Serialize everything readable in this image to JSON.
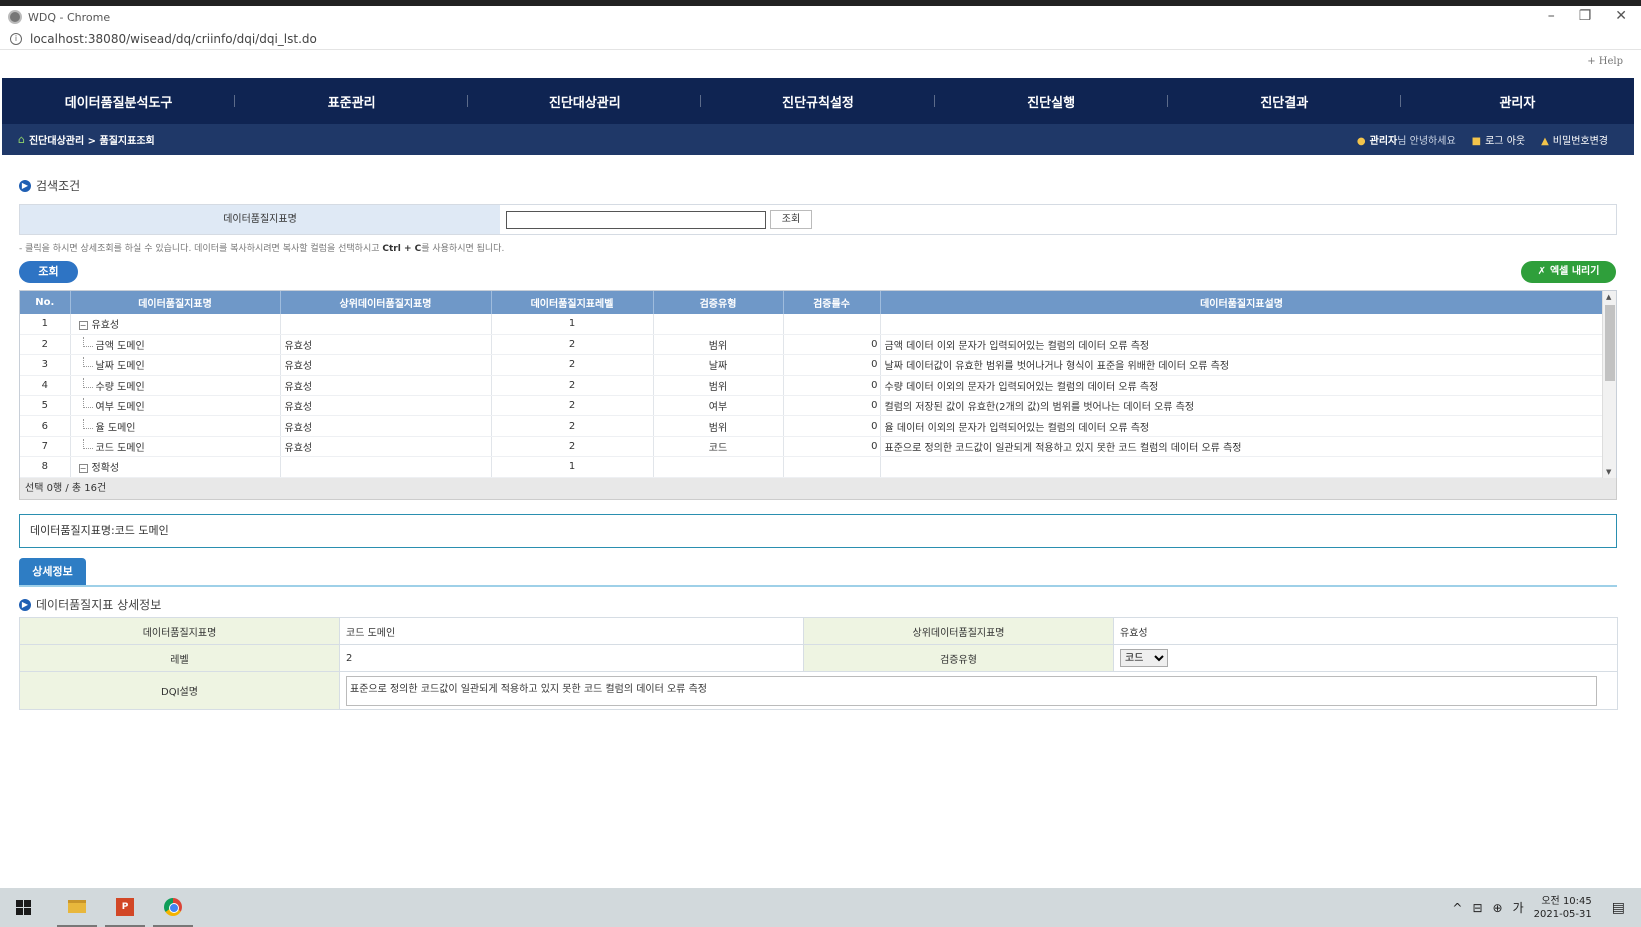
{
  "window": {
    "title": "WDQ - Chrome",
    "url": "localhost:38080/wisead/dq/criinfo/dqi/dqi_lst.do",
    "minimize": "–",
    "restore": "❐",
    "close": "✕"
  },
  "help": "+ Help",
  "nav": {
    "items": [
      "데이터품질분석도구",
      "표준관리",
      "진단대상관리",
      "진단규칙설정",
      "진단실행",
      "진단결과",
      "관리자"
    ]
  },
  "subbar": {
    "breadcrumb": "진단대상관리 > 품질지표조회",
    "user_name": "관리자",
    "user_greeting": "님 안녕하세요",
    "logout": "로그 아웃",
    "change_password": "비밀번호변경"
  },
  "search": {
    "section_title": "검색조건",
    "field_label": "데이터품질지표명",
    "field_value": "",
    "inline_button": "조회",
    "note_pre": "- 클릭을 하시면 상세조회를 하실 수 있습니다. 데이터를 복사하시려면 복사할 컬럼을 선택하시고 ",
    "note_key": "Ctrl + C",
    "note_post": "를 사용하시면 됩니다.",
    "query_button": "조회",
    "excel_button": "엑셀 내리기"
  },
  "grid": {
    "columns": [
      "No.",
      "데이터품질지표명",
      "상위데이터품질지표명",
      "데이터품질지표레벨",
      "검증유형",
      "검증룰수",
      "데이터품질지표설명"
    ],
    "rows": [
      {
        "no": "1",
        "name": "유효성",
        "parent": "",
        "level": "1",
        "type": "",
        "rules": "",
        "desc": "",
        "tree": "root"
      },
      {
        "no": "2",
        "name": "금액 도메인",
        "parent": "유효성",
        "level": "2",
        "type": "범위",
        "rules": "0",
        "desc": "금액 데이터 이외 문자가 입력되어있는 컬럼의 데이터 오류 측정",
        "tree": "leaf"
      },
      {
        "no": "3",
        "name": "날짜 도메인",
        "parent": "유효성",
        "level": "2",
        "type": "날짜",
        "rules": "0",
        "desc": "날짜 데이터값이 유효한 범위를 벗어나거나 형식이 표준을 위배한 데이터 오류 측정",
        "tree": "leaf"
      },
      {
        "no": "4",
        "name": "수량 도메인",
        "parent": "유효성",
        "level": "2",
        "type": "범위",
        "rules": "0",
        "desc": "수량 데이터 이외의 문자가 입력되어있는 컬럼의 데이터 오류 측정",
        "tree": "leaf"
      },
      {
        "no": "5",
        "name": "여부 도메인",
        "parent": "유효성",
        "level": "2",
        "type": "여부",
        "rules": "0",
        "desc": "컬럼의 저장된 값이 유효한(2개의 값)의 범위를 벗어나는 데이터 오류 측정",
        "tree": "leaf"
      },
      {
        "no": "6",
        "name": "율 도메인",
        "parent": "유효성",
        "level": "2",
        "type": "범위",
        "rules": "0",
        "desc": "율 데이터 이외의 문자가 입력되어있는 컬럼의 데이터 오류 측정",
        "tree": "leaf"
      },
      {
        "no": "7",
        "name": "코드 도메인",
        "parent": "유효성",
        "level": "2",
        "type": "코드",
        "rules": "0",
        "desc": "표준으로 정의한 코드값이 일관되게 적용하고 있지 못한 코드 컬럼의 데이터 오류 측정",
        "tree": "leaf"
      },
      {
        "no": "8",
        "name": "정확성",
        "parent": "",
        "level": "1",
        "type": "",
        "rules": "",
        "desc": "",
        "tree": "root"
      }
    ],
    "footer": "선택 0행 / 총 16건"
  },
  "selected": "데이터품질지표명:코드 도메인",
  "detail": {
    "tab_label": "상세정보",
    "section_title": "데이터품질지표 상세정보",
    "name_label": "데이터품질지표명",
    "name_value": "코드 도메인",
    "parent_label": "상위데이터품질지표명",
    "parent_value": "유효성",
    "level_label": "레벨",
    "level_value": "2",
    "type_label": "검증유형",
    "type_value": "코드",
    "desc_label": "DQI설명",
    "desc_value": "표준으로 정의한 코드값이 일관되게 적용하고 있지 못한 코드 컬럼의 데이터 오류 측정"
  },
  "taskbar": {
    "ppt_label": "P",
    "ime": "가",
    "time": "오전 10:45",
    "date": "2021-05-31"
  }
}
